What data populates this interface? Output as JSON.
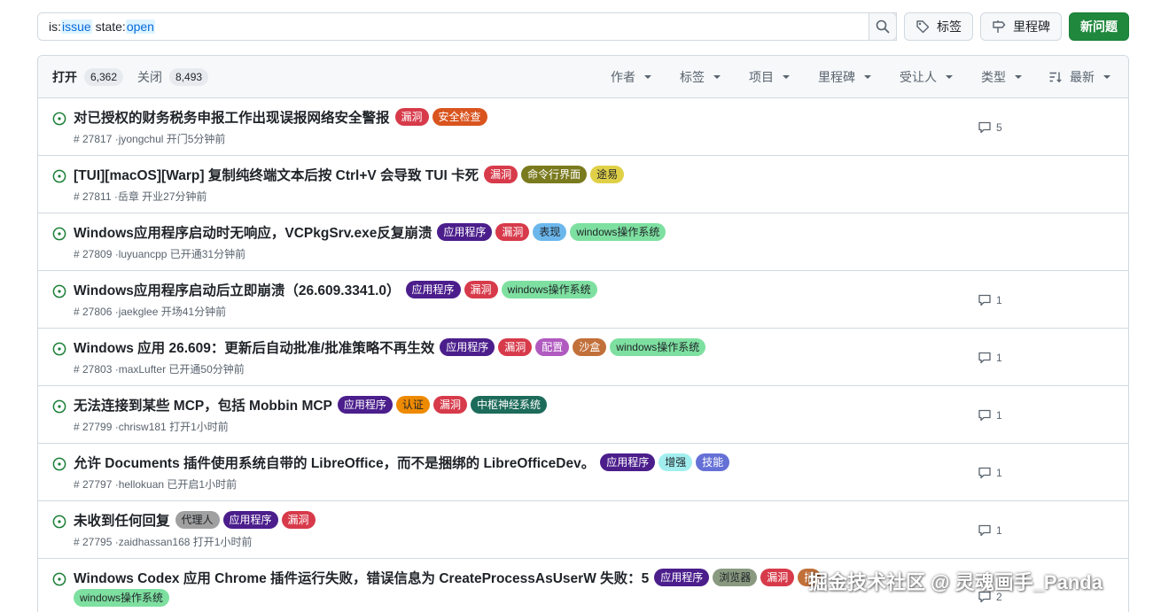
{
  "search": {
    "tokens": [
      {
        "key": "is:",
        "val": "issue"
      },
      {
        "key": " state:",
        "val": "open"
      }
    ]
  },
  "toolbar": {
    "labels_label": "标签",
    "milestones_label": "里程碑",
    "new_issue_label": "新问题"
  },
  "header": {
    "open_label": "打开",
    "open_count": "6,362",
    "closed_label": "关闭",
    "closed_count": "8,493",
    "filters": [
      "作者",
      "标签",
      "项目",
      "里程碑",
      "受让人",
      "类型",
      "最新"
    ]
  },
  "colors": {
    "open_icon": "#1a7f37",
    "primary_button": "#1f883d"
  },
  "issues": [
    {
      "title": "对已授权的财务税务申报工作出现误报网络安全警报",
      "labels": [
        {
          "text": "漏洞",
          "bg": "#d73a4a",
          "fg": "#ffffff"
        },
        {
          "text": "安全检查",
          "bg": "#d9541e",
          "fg": "#ffffff"
        }
      ],
      "meta": "# 27817 ·jyongchul 开门5分钟前",
      "comments": "5"
    },
    {
      "title": "[TUI][macOS][Warp] 复制纯终端文本后按 Ctrl+V 会导致 TUI 卡死",
      "labels": [
        {
          "text": "漏洞",
          "bg": "#d73a4a",
          "fg": "#ffffff"
        },
        {
          "text": "命令行界面",
          "bg": "#7a7a1e",
          "fg": "#ffffff"
        },
        {
          "text": "途易",
          "bg": "#e0d048",
          "fg": "#1f2328"
        }
      ],
      "meta": "# 27811 ·岳章 开业27分钟前",
      "comments": ""
    },
    {
      "title": "Windows应用程序启动时无响应，VCPkgSrv.exe反复崩溃",
      "labels": [
        {
          "text": "应用程序",
          "bg": "#4b1e8c",
          "fg": "#ffffff"
        },
        {
          "text": "漏洞",
          "bg": "#d73a4a",
          "fg": "#ffffff"
        },
        {
          "text": "表现",
          "bg": "#6bb7ec",
          "fg": "#1f2328"
        },
        {
          "text": "windows操作系统",
          "bg": "#7ee0a0",
          "fg": "#1f2328"
        }
      ],
      "meta": "# 27809 ·luyuancpp 已开通31分钟前",
      "comments": ""
    },
    {
      "title": "Windows应用程序启动后立即崩溃（26.609.3341.0）",
      "labels": [
        {
          "text": "应用程序",
          "bg": "#4b1e8c",
          "fg": "#ffffff"
        },
        {
          "text": "漏洞",
          "bg": "#d73a4a",
          "fg": "#ffffff"
        },
        {
          "text": "windows操作系统",
          "bg": "#7ee0a0",
          "fg": "#1f2328"
        }
      ],
      "meta": "# 27806 ·jaekglee 开场41分钟前",
      "comments": "1"
    },
    {
      "title": "Windows 应用 26.609：更新后自动批准/批准策略不再生效",
      "labels": [
        {
          "text": "应用程序",
          "bg": "#4b1e8c",
          "fg": "#ffffff"
        },
        {
          "text": "漏洞",
          "bg": "#d73a4a",
          "fg": "#ffffff"
        },
        {
          "text": "配置",
          "bg": "#b05ac0",
          "fg": "#ffffff"
        },
        {
          "text": "沙盒",
          "bg": "#c2703a",
          "fg": "#ffffff"
        },
        {
          "text": "windows操作系统",
          "bg": "#7ee0a0",
          "fg": "#1f2328"
        }
      ],
      "meta": "# 27803 ·maxLufter 已开通50分钟前",
      "comments": "1"
    },
    {
      "title": "无法连接到某些 MCP，包括 Mobbin MCP",
      "labels": [
        {
          "text": "应用程序",
          "bg": "#4b1e8c",
          "fg": "#ffffff"
        },
        {
          "text": "认证",
          "bg": "#ee8a00",
          "fg": "#1f2328"
        },
        {
          "text": "漏洞",
          "bg": "#d73a4a",
          "fg": "#ffffff"
        },
        {
          "text": "中枢神经系统",
          "bg": "#1d6b5a",
          "fg": "#ffffff"
        }
      ],
      "meta": "# 27799 ·chrisw181 打开1小时前",
      "comments": "1"
    },
    {
      "title": "允许 Documents 插件使用系统自带的 LibreOffice，而不是捆绑的 LibreOfficeDev。",
      "labels": [
        {
          "text": "应用程序",
          "bg": "#4b1e8c",
          "fg": "#ffffff"
        },
        {
          "text": "增强",
          "bg": "#a2eeef",
          "fg": "#1f2328"
        },
        {
          "text": "技能",
          "bg": "#6570d6",
          "fg": "#ffffff"
        }
      ],
      "meta": "# 27797 ·hellokuan 已开启1小时前",
      "comments": "1"
    },
    {
      "title": "未收到任何回复",
      "labels": [
        {
          "text": "代理人",
          "bg": "#a0a0a0",
          "fg": "#1f2328"
        },
        {
          "text": "应用程序",
          "bg": "#4b1e8c",
          "fg": "#ffffff"
        },
        {
          "text": "漏洞",
          "bg": "#d73a4a",
          "fg": "#ffffff"
        }
      ],
      "meta": "# 27795 ·zaidhassan168 打开1小时前",
      "comments": "1"
    },
    {
      "title": "Windows Codex 应用 Chrome 插件运行失败，错误信息为 CreateProcessAsUserW 失败：5",
      "labels": [
        {
          "text": "应用程序",
          "bg": "#4b1e8c",
          "fg": "#ffffff"
        },
        {
          "text": "浏览器",
          "bg": "#8a9a80",
          "fg": "#1f2328"
        },
        {
          "text": "漏洞",
          "bg": "#d73a4a",
          "fg": "#ffffff"
        },
        {
          "text": "插",
          "bg": "#c2703a",
          "fg": "#ffffff"
        },
        {
          "text": "windows操作系统",
          "bg": "#7ee0a0",
          "fg": "#1f2328"
        }
      ],
      "meta": "",
      "comments": "2"
    }
  ],
  "watermark": "掘金技术社区 @ 灵魂画手_Panda"
}
